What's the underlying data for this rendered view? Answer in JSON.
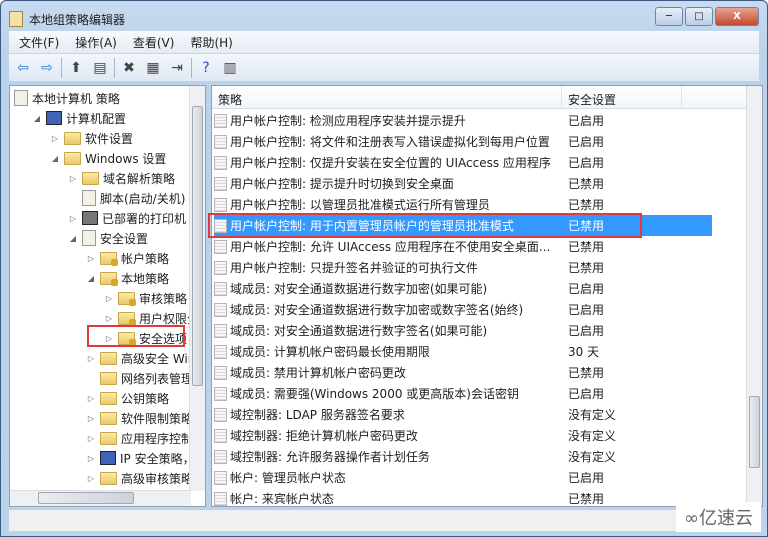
{
  "window": {
    "title": "本地组策略编辑器",
    "min": "─",
    "max": "□",
    "close": "X"
  },
  "menu": [
    "文件(F)",
    "操作(A)",
    "查看(V)",
    "帮助(H)"
  ],
  "toolbar": [
    {
      "icon": "back-arrow-icon",
      "glyph": "⇦"
    },
    {
      "icon": "forward-arrow-icon",
      "glyph": "⇨"
    },
    {
      "icon": "up-folder-icon",
      "glyph": "⬆"
    },
    {
      "icon": "show-hide-tree-icon",
      "glyph": "▤"
    },
    {
      "icon": "delete-icon",
      "glyph": "✖"
    },
    {
      "icon": "properties-icon",
      "glyph": "▦"
    },
    {
      "icon": "export-list-icon",
      "glyph": "⇥"
    },
    {
      "icon": "help-icon",
      "glyph": "?"
    },
    {
      "icon": "show-action-pane-icon",
      "glyph": "▥"
    }
  ],
  "tree": [
    {
      "label": "本地计算机 策略",
      "level": 0,
      "icon": "doc",
      "arrow": ""
    },
    {
      "label": "计算机配置",
      "level": 1,
      "icon": "pc",
      "arrow": "◢"
    },
    {
      "label": "软件设置",
      "level": 2,
      "icon": "folder",
      "arrow": "▷"
    },
    {
      "label": "Windows 设置",
      "level": 2,
      "icon": "folder",
      "arrow": "◢"
    },
    {
      "label": "域名解析策略",
      "level": 3,
      "icon": "folder",
      "arrow": "▷"
    },
    {
      "label": "脚本(启动/关机)",
      "level": 3,
      "icon": "doc",
      "arrow": ""
    },
    {
      "label": "已部署的打印机",
      "level": 3,
      "icon": "printer",
      "arrow": "▷"
    },
    {
      "label": "安全设置",
      "level": 3,
      "icon": "lockdoc",
      "arrow": "◢"
    },
    {
      "label": "帐户策略",
      "level": 4,
      "icon": "lockfolder",
      "arrow": "▷"
    },
    {
      "label": "本地策略",
      "level": 4,
      "icon": "lockfolder",
      "arrow": "◢"
    },
    {
      "label": "审核策略",
      "level": 5,
      "icon": "lockfolder",
      "arrow": "▷"
    },
    {
      "label": "用户权限分配",
      "level": 5,
      "icon": "lockfolder",
      "arrow": "▷"
    },
    {
      "label": "安全选项",
      "level": 5,
      "icon": "lockfolder",
      "arrow": "▷",
      "highlighted": true
    },
    {
      "label": "高级安全 Windows 防火墙",
      "level": 4,
      "icon": "folder",
      "arrow": "▷"
    },
    {
      "label": "网络列表管理器策略",
      "level": 4,
      "icon": "folder",
      "arrow": ""
    },
    {
      "label": "公钥策略",
      "level": 4,
      "icon": "folder",
      "arrow": "▷"
    },
    {
      "label": "软件限制策略",
      "level": 4,
      "icon": "folder",
      "arrow": "▷"
    },
    {
      "label": "应用程序控制策略",
      "level": 4,
      "icon": "folder",
      "arrow": "▷"
    },
    {
      "label": "IP 安全策略，在 本地计算机",
      "level": 4,
      "icon": "pc",
      "arrow": "▷"
    },
    {
      "label": "高级审核策略配置",
      "level": 4,
      "icon": "folder",
      "arrow": "▷"
    }
  ],
  "list": {
    "columns": [
      "策略",
      "安全设置"
    ],
    "rows": [
      [
        "用户帐户控制: 检测应用程序安装并提示提升",
        "已启用"
      ],
      [
        "用户帐户控制: 将文件和注册表写入错误虚拟化到每用户位置",
        "已启用"
      ],
      [
        "用户帐户控制: 仅提升安装在安全位置的 UIAccess 应用程序",
        "已启用"
      ],
      [
        "用户帐户控制: 提示提升时切换到安全桌面",
        "已禁用"
      ],
      [
        "用户帐户控制: 以管理员批准模式运行所有管理员",
        "已禁用"
      ],
      [
        "用户帐户控制: 用于内置管理员帐户的管理员批准模式",
        "已禁用"
      ],
      [
        "用户帐户控制: 允许 UIAccess 应用程序在不使用安全桌面...",
        "已禁用"
      ],
      [
        "用户帐户控制: 只提升签名并验证的可执行文件",
        "已禁用"
      ],
      [
        "域成员: 对安全通道数据进行数字加密(如果可能)",
        "已启用"
      ],
      [
        "域成员: 对安全通道数据进行数字加密或数字签名(始终)",
        "已启用"
      ],
      [
        "域成员: 对安全通道数据进行数字签名(如果可能)",
        "已启用"
      ],
      [
        "域成员: 计算机帐户密码最长使用期限",
        "30 天"
      ],
      [
        "域成员: 禁用计算机帐户密码更改",
        "已禁用"
      ],
      [
        "域成员: 需要强(Windows 2000 或更高版本)会话密钥",
        "已启用"
      ],
      [
        "域控制器: LDAP 服务器签名要求",
        "没有定义"
      ],
      [
        "域控制器: 拒绝计算机帐户密码更改",
        "没有定义"
      ],
      [
        "域控制器: 允许服务器操作者计划任务",
        "没有定义"
      ],
      [
        "帐户: 管理员帐户状态",
        "已启用"
      ],
      [
        "帐户: 来宾帐户状态",
        "已禁用"
      ]
    ],
    "selected_index": 5
  },
  "watermark": "亿速云",
  "colors": {
    "selection": "#3399ff",
    "highlight_box": "#e03a3a"
  }
}
